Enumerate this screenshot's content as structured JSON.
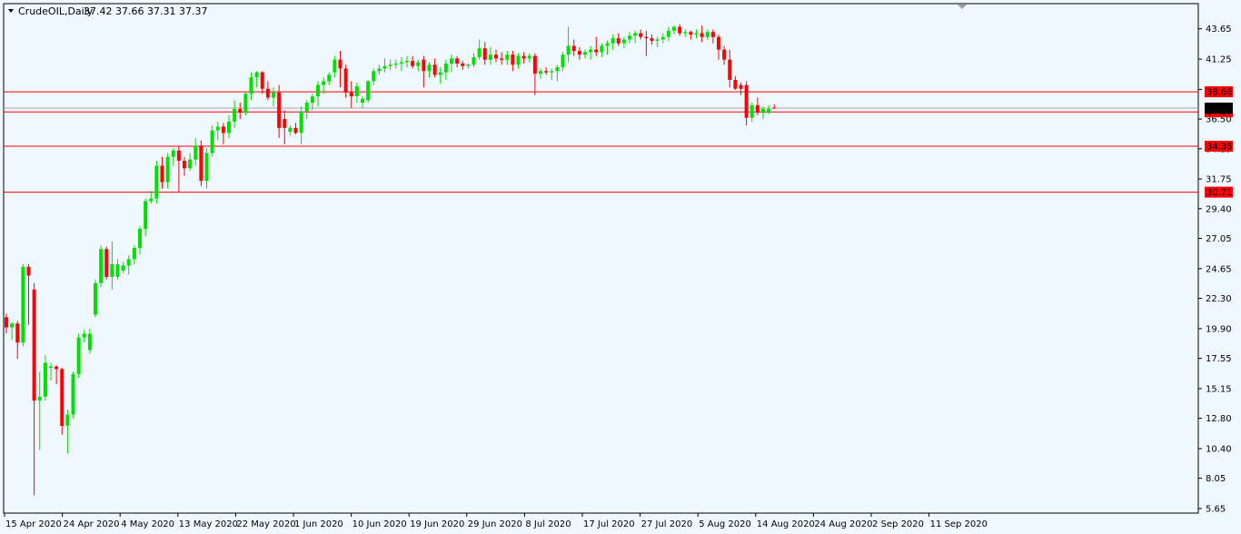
{
  "chart_data": {
    "type": "candlestick",
    "symbol": "CrudeOIL,Daily",
    "ohlc_display": "37.42 37.66 37.31 37.37",
    "y_ticks": [
      "43.65",
      "41.25",
      "38.85",
      "36.50",
      "34.15",
      "31.75",
      "29.40",
      "27.05",
      "24.65",
      "22.30",
      "19.90",
      "17.55",
      "15.15",
      "12.80",
      "10.40",
      "8.05",
      "5.65"
    ],
    "ylim": [
      5.65,
      44.85
    ],
    "x_labels": [
      "15 Apr 2020",
      "24 Apr 2020",
      "4 May 2020",
      "13 May 2020",
      "22 May 2020",
      "1 Jun 2020",
      "10 Jun 2020",
      "19 Jun 2020",
      "29 Jun 2020",
      "8 Jul 2020",
      "17 Jul 2020",
      "27 Jul 2020",
      "5 Aug 2020",
      "14 Aug 2020",
      "24 Aug 2020",
      "2 Sep 2020",
      "11 Sep 2020"
    ],
    "horizontal_lines": [
      {
        "value": 38.66,
        "label": "38.66",
        "color": "#ff0000"
      },
      {
        "value": 37.07,
        "label": "37.07",
        "color": "#ff0000"
      },
      {
        "value": 34.35,
        "label": "34.35",
        "color": "#ff0000"
      },
      {
        "value": 30.71,
        "label": "30.71",
        "color": "#ff0000"
      }
    ],
    "current_price": {
      "value": 37.37,
      "label": "37.37",
      "color": "#000000"
    },
    "grid": false,
    "up_color": "#00e000",
    "down_color": "#ff0000",
    "candles": [
      [
        20.8,
        21.1,
        19.5,
        20.0
      ],
      [
        20.0,
        20.4,
        19.0,
        20.3
      ],
      [
        20.3,
        20.5,
        17.5,
        18.8
      ],
      [
        18.8,
        25.0,
        18.5,
        24.8
      ],
      [
        24.8,
        25.0,
        20.2,
        24.1
      ],
      [
        23.0,
        23.5,
        6.7,
        14.2
      ],
      [
        14.2,
        16.5,
        10.3,
        14.5
      ],
      [
        14.5,
        17.8,
        14.2,
        17.2
      ],
      [
        16.8,
        17.2,
        15.8,
        16.9
      ],
      [
        16.9,
        17.0,
        15.5,
        16.7
      ],
      [
        16.7,
        16.8,
        11.5,
        12.2
      ],
      [
        12.2,
        13.5,
        10.0,
        13.1
      ],
      [
        13.1,
        16.5,
        12.8,
        16.3
      ],
      [
        16.3,
        19.5,
        16.0,
        19.2
      ],
      [
        19.2,
        19.8,
        18.8,
        19.5
      ],
      [
        18.2,
        19.9,
        17.9,
        19.5
      ],
      [
        21.0,
        23.8,
        20.8,
        23.5
      ],
      [
        23.5,
        26.5,
        23.2,
        26.2
      ],
      [
        26.2,
        26.4,
        23.8,
        24.0
      ],
      [
        24.0,
        26.8,
        23.0,
        25.0
      ],
      [
        24.0,
        25.4,
        23.8,
        25.0
      ],
      [
        24.5,
        25.2,
        24.3,
        24.9
      ],
      [
        24.9,
        25.7,
        24.2,
        25.4
      ],
      [
        25.4,
        26.5,
        25.0,
        26.3
      ],
      [
        26.3,
        28.0,
        25.8,
        27.8
      ],
      [
        27.8,
        30.2,
        27.2,
        30.0
      ],
      [
        30.0,
        30.8,
        29.8,
        30.2
      ],
      [
        30.2,
        33.2,
        29.8,
        32.8
      ],
      [
        32.8,
        33.5,
        31.0,
        31.5
      ],
      [
        31.5,
        33.8,
        31.0,
        33.5
      ],
      [
        33.5,
        34.2,
        32.8,
        34.0
      ],
      [
        34.0,
        34.3,
        30.7,
        33.2
      ],
      [
        33.2,
        33.5,
        32.0,
        32.6
      ],
      [
        32.6,
        33.8,
        32.4,
        33.3
      ],
      [
        33.3,
        35.0,
        32.8,
        34.4
      ],
      [
        34.4,
        34.8,
        31.2,
        31.6
      ],
      [
        31.6,
        34.2,
        31.0,
        33.8
      ],
      [
        33.8,
        36.0,
        33.5,
        35.6
      ],
      [
        35.6,
        36.3,
        34.8,
        35.9
      ],
      [
        35.9,
        36.2,
        34.5,
        35.4
      ],
      [
        35.4,
        36.8,
        35.0,
        36.3
      ],
      [
        36.3,
        38.0,
        35.8,
        37.3
      ],
      [
        37.3,
        37.8,
        36.5,
        37.0
      ],
      [
        37.0,
        38.6,
        36.8,
        38.5
      ],
      [
        38.5,
        40.2,
        38.0,
        39.8
      ],
      [
        39.8,
        40.3,
        39.0,
        40.2
      ],
      [
        40.2,
        40.3,
        38.5,
        38.9
      ],
      [
        38.9,
        39.5,
        38.0,
        38.2
      ],
      [
        38.2,
        39.0,
        37.5,
        38.6
      ],
      [
        38.6,
        39.2,
        35.0,
        35.8
      ],
      [
        36.5,
        37.2,
        34.5,
        35.8
      ],
      [
        35.5,
        36.0,
        35.2,
        35.8
      ],
      [
        35.8,
        36.2,
        35.3,
        35.4
      ],
      [
        35.4,
        37.5,
        34.5,
        37.1
      ],
      [
        37.1,
        38.0,
        36.5,
        37.8
      ],
      [
        37.8,
        38.5,
        37.2,
        38.3
      ],
      [
        38.3,
        39.5,
        37.5,
        39.2
      ],
      [
        39.2,
        39.8,
        38.5,
        39.5
      ],
      [
        39.5,
        40.2,
        39.2,
        40.0
      ],
      [
        40.2,
        41.5,
        39.8,
        41.2
      ],
      [
        41.2,
        41.9,
        39.0,
        40.5
      ],
      [
        40.5,
        40.8,
        38.2,
        38.6
      ],
      [
        38.6,
        39.5,
        37.4,
        38.3
      ],
      [
        38.3,
        39.4,
        37.8,
        39.1
      ],
      [
        37.8,
        38.3,
        37.4,
        38.1
      ],
      [
        38.0,
        39.6,
        37.8,
        39.5
      ],
      [
        39.5,
        40.5,
        39.2,
        40.3
      ],
      [
        40.3,
        40.8,
        40.0,
        40.5
      ],
      [
        40.5,
        41.3,
        40.2,
        40.7
      ],
      [
        40.7,
        41.2,
        40.4,
        40.8
      ],
      [
        40.8,
        41.2,
        40.5,
        40.9
      ],
      [
        40.9,
        41.4,
        40.3,
        41.0
      ],
      [
        41.0,
        41.5,
        40.6,
        41.1
      ],
      [
        41.1,
        41.5,
        40.5,
        40.7
      ],
      [
        40.7,
        41.2,
        40.3,
        41.0
      ],
      [
        41.2,
        41.5,
        39.0,
        40.3
      ],
      [
        40.3,
        41.0,
        39.8,
        40.8
      ],
      [
        40.8,
        41.3,
        39.8,
        40.0
      ],
      [
        40.0,
        40.6,
        39.3,
        40.2
      ],
      [
        40.2,
        41.2,
        39.6,
        40.9
      ],
      [
        40.9,
        41.6,
        40.2,
        41.3
      ],
      [
        41.3,
        41.5,
        40.6,
        40.9
      ],
      [
        40.9,
        41.1,
        40.4,
        40.7
      ],
      [
        40.7,
        40.9,
        40.5,
        40.8
      ],
      [
        40.8,
        41.7,
        40.6,
        41.4
      ],
      [
        41.4,
        42.8,
        41.2,
        42.1
      ],
      [
        42.1,
        42.6,
        40.8,
        41.2
      ],
      [
        41.2,
        42.2,
        40.8,
        41.6
      ],
      [
        41.6,
        42.0,
        41.0,
        41.3
      ],
      [
        41.3,
        41.8,
        40.8,
        41.2
      ],
      [
        41.2,
        41.9,
        40.8,
        41.6
      ],
      [
        41.6,
        41.9,
        40.3,
        40.8
      ],
      [
        40.8,
        41.7,
        40.5,
        41.5
      ],
      [
        41.5,
        41.8,
        40.9,
        41.3
      ],
      [
        41.3,
        41.7,
        41.0,
        41.5
      ],
      [
        41.5,
        41.7,
        38.4,
        40.1
      ],
      [
        40.1,
        40.5,
        39.7,
        40.3
      ],
      [
        40.3,
        40.6,
        40.0,
        40.2
      ],
      [
        40.2,
        40.5,
        39.6,
        40.3
      ],
      [
        40.3,
        40.8,
        39.5,
        40.6
      ],
      [
        40.6,
        41.8,
        40.3,
        41.6
      ],
      [
        41.6,
        43.8,
        41.0,
        42.3
      ],
      [
        42.3,
        42.8,
        41.5,
        41.9
      ],
      [
        41.9,
        42.2,
        41.2,
        41.6
      ],
      [
        41.6,
        42.0,
        41.3,
        41.8
      ],
      [
        41.8,
        42.3,
        41.2,
        42.0
      ],
      [
        42.0,
        43.0,
        41.5,
        41.8
      ],
      [
        41.8,
        42.5,
        41.4,
        42.3
      ],
      [
        42.3,
        42.7,
        41.6,
        42.5
      ],
      [
        42.5,
        43.2,
        42.0,
        42.9
      ],
      [
        42.9,
        43.3,
        42.3,
        42.5
      ],
      [
        42.5,
        43.0,
        42.1,
        42.8
      ],
      [
        42.8,
        43.4,
        42.5,
        43.1
      ],
      [
        43.1,
        43.5,
        42.5,
        43.3
      ],
      [
        43.3,
        43.6,
        42.8,
        43.0
      ],
      [
        43.0,
        43.5,
        41.5,
        42.9
      ],
      [
        42.9,
        43.2,
        42.4,
        42.7
      ],
      [
        42.7,
        43.0,
        42.2,
        42.8
      ],
      [
        42.8,
        43.3,
        42.5,
        43.0
      ],
      [
        43.0,
        43.8,
        42.7,
        43.5
      ],
      [
        43.5,
        43.9,
        43.2,
        43.8
      ],
      [
        43.8,
        44.0,
        43.1,
        43.3
      ],
      [
        43.3,
        43.6,
        43.0,
        43.4
      ],
      [
        43.4,
        43.5,
        42.8,
        43.2
      ],
      [
        43.2,
        43.6,
        42.9,
        43.3
      ],
      [
        43.3,
        43.9,
        42.6,
        43.0
      ],
      [
        43.0,
        43.6,
        42.8,
        43.4
      ],
      [
        43.4,
        43.6,
        42.5,
        43.0
      ],
      [
        43.0,
        43.2,
        41.2,
        42.0
      ],
      [
        42.0,
        42.3,
        40.8,
        41.2
      ],
      [
        41.2,
        42.0,
        39.0,
        39.6
      ],
      [
        39.6,
        39.9,
        38.8,
        38.9
      ],
      [
        39.2,
        39.4,
        38.4,
        38.9
      ],
      [
        39.2,
        39.5,
        36.0,
        36.6
      ],
      [
        36.6,
        37.8,
        36.3,
        37.6
      ],
      [
        37.6,
        38.2,
        36.8,
        37.0
      ],
      [
        37.0,
        37.5,
        36.5,
        37.3
      ],
      [
        37.0,
        37.6,
        36.9,
        37.3
      ],
      [
        37.4,
        37.66,
        37.31,
        37.37
      ]
    ]
  }
}
